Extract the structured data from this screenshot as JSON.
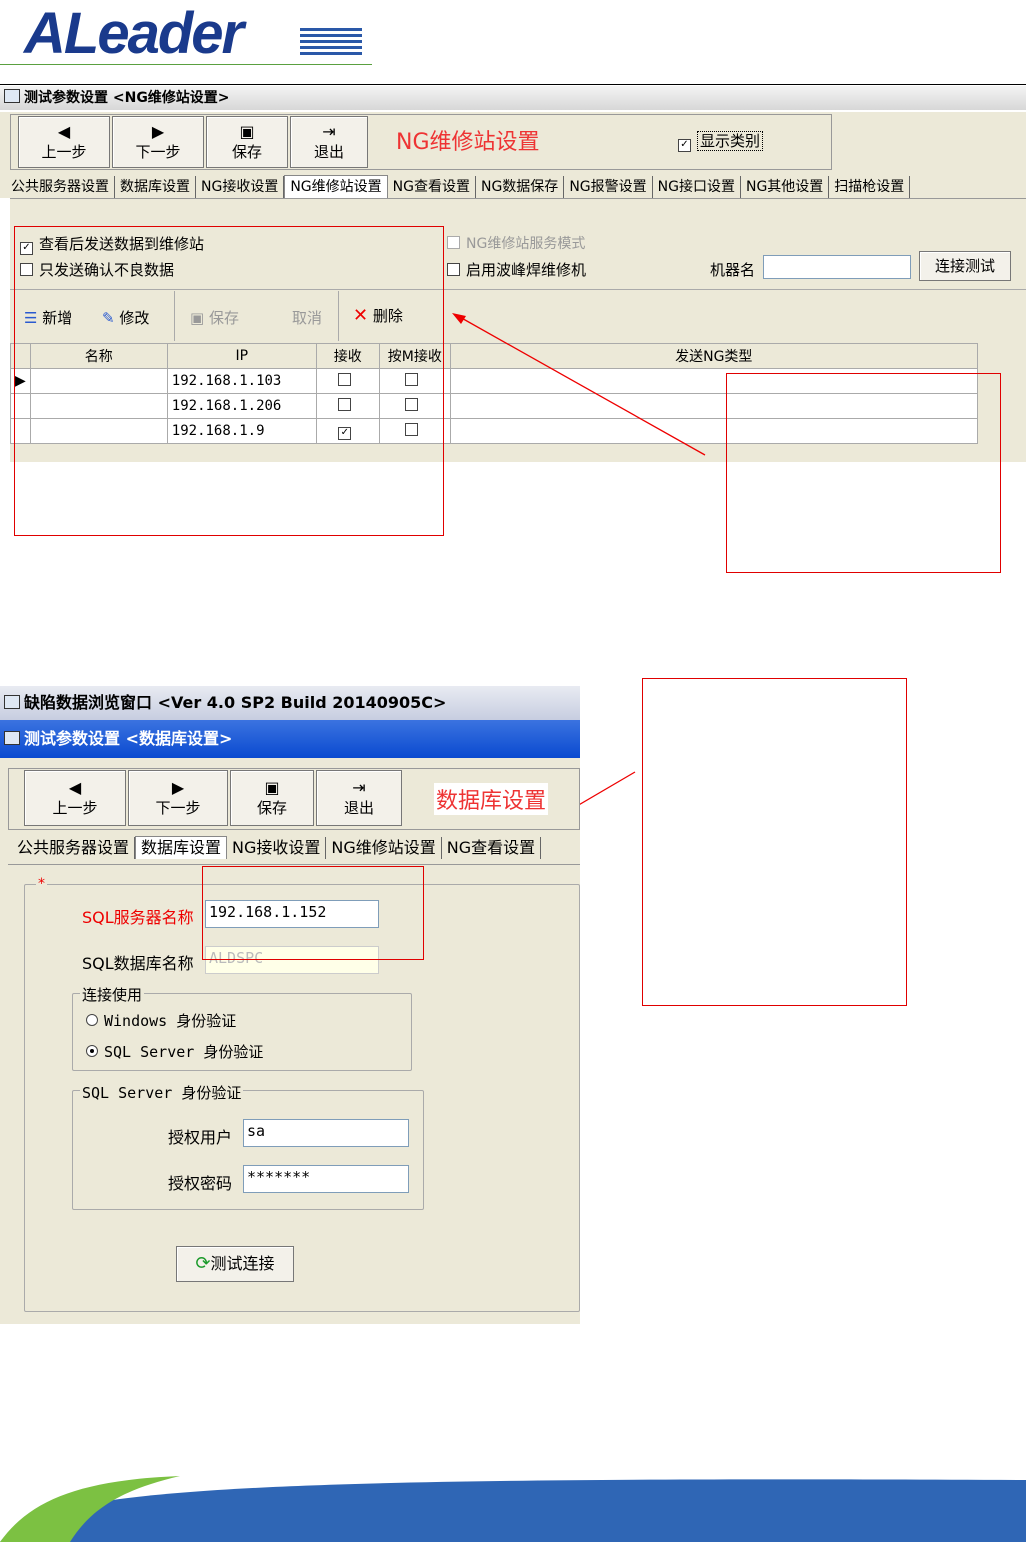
{
  "logo": {
    "text": "ALeader"
  },
  "shot1": {
    "title": "测试参数设置 <NG维修站设置>",
    "toolbar": [
      {
        "icon": "◀",
        "label": "上一步"
      },
      {
        "icon": "▶",
        "label": "下一步"
      },
      {
        "icon": "▣",
        "label": "保存"
      },
      {
        "icon": "⇥",
        "label": "退出"
      }
    ],
    "heading": "NG维修站设置",
    "show_category": {
      "label": "显示类别",
      "checked": true
    },
    "tabs": [
      "公共服务器设置",
      "数据库设置",
      "NG接收设置",
      "NG维修站设置",
      "NG查看设置",
      "NG数据保存",
      "NG报警设置",
      "NG接口设置",
      "NG其他设置",
      "扫描枪设置"
    ],
    "active_tab": 3,
    "options": {
      "send_after_view": "查看后发送数据到维修站",
      "send_confirmed_only": "只发送确认不良数据",
      "service_mode": "NG维修站服务模式",
      "wave_solder": "启用波峰焊维修机",
      "machine_name_label": "机器名",
      "machine_name_value": "",
      "connect_test": "连接测试"
    },
    "actions": {
      "add": "新增",
      "edit": "修改",
      "save": "保存",
      "cancel": "取消",
      "delete": "删除"
    },
    "columns": [
      "名称",
      "IP",
      "接收",
      "按M接收",
      "发送NG类型"
    ],
    "rows": [
      {
        "name": "",
        "ip": "192.168.1.103",
        "recv": false,
        "mrecv": false
      },
      {
        "name": "",
        "ip": "192.168.1.206",
        "recv": false,
        "mrecv": false
      },
      {
        "name": "",
        "ip": "192.168.1.9",
        "recv": true,
        "mrecv": false
      }
    ]
  },
  "shot2": {
    "app_title": "缺陷数据浏览窗口 <Ver 4.0 SP2 Build 20140905C>",
    "title": "测试参数设置 <数据库设置>",
    "toolbar": [
      {
        "icon": "◀",
        "label": "上一步"
      },
      {
        "icon": "▶",
        "label": "下一步"
      },
      {
        "icon": "▣",
        "label": "保存"
      },
      {
        "icon": "⇥",
        "label": "退出"
      }
    ],
    "heading": "数据库设置",
    "tabs": [
      "公共服务器设置",
      "数据库设置",
      "NG接收设置",
      "NG维修站设置",
      "NG查看设置"
    ],
    "active_tab": 1,
    "required_mark": "*",
    "sql_server_label": "SQL服务器名称",
    "sql_server_value": "192.168.1.152",
    "sql_db_label": "SQL数据库名称",
    "sql_db_value": "ALDSPC",
    "connect_group": "连接使用",
    "auth_windows": "Windows 身份验证",
    "auth_sql": "SQL Server 身份验证",
    "sql_auth_group": "SQL Server 身份验证",
    "user_label": "授权用户",
    "user_value": "sa",
    "pwd_label": "授权密码",
    "pwd_value": "*******",
    "test_button": "测试连接"
  }
}
